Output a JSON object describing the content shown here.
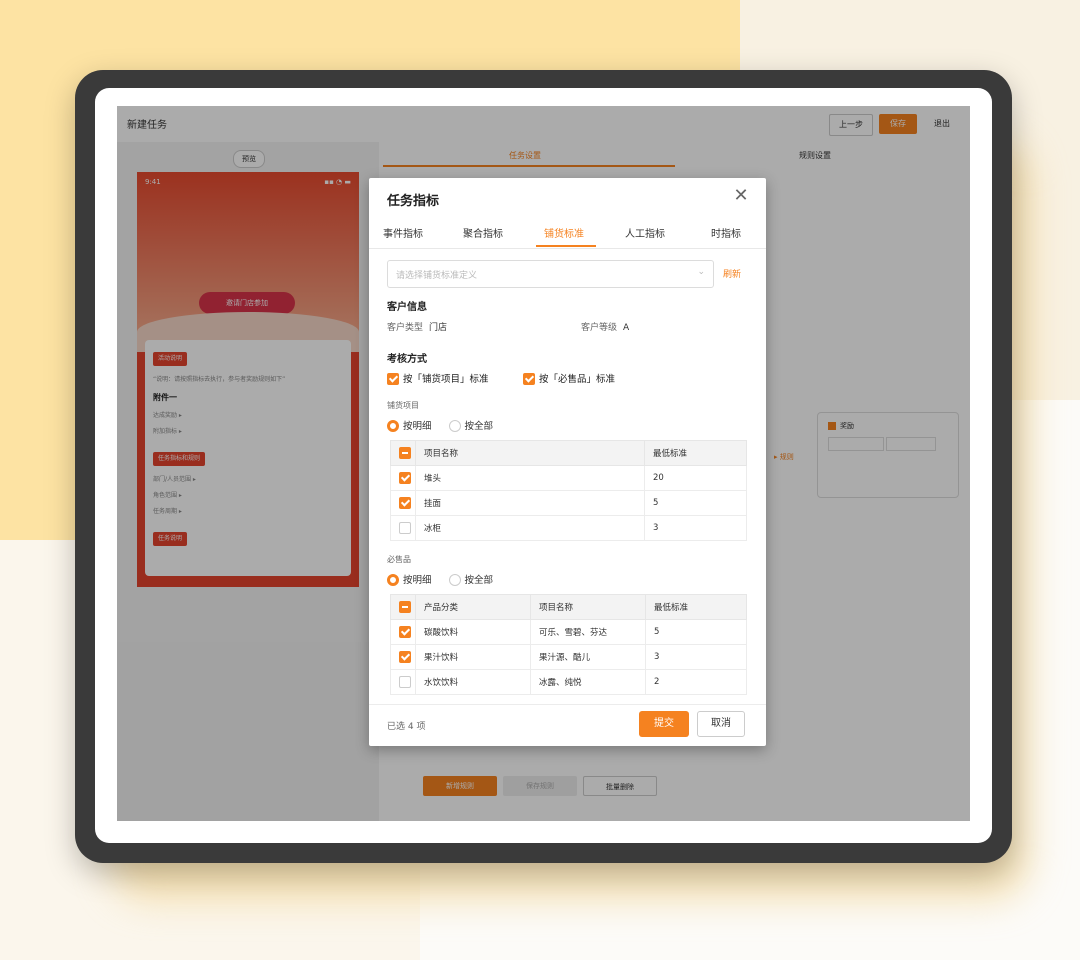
{
  "colors": {
    "accent": "#f58220",
    "phone_red": "#e4432e",
    "bg_yellow": "#fde3a3"
  },
  "app": {
    "title": "新建任务",
    "buttons": {
      "prev": "上一步",
      "save": "保存",
      "exit": "退出"
    },
    "preview_label": "预览",
    "right_tabs": [
      "任务设置",
      "规则设置"
    ],
    "bottom_buttons": [
      "新增规则",
      "保存规则",
      "批量删除"
    ]
  },
  "phone": {
    "time": "9:41",
    "status": "▪▪ ◔ ▬",
    "center_button": "邀请门店参加",
    "tags": [
      "活动说明",
      "任务指标和规则",
      "任务说明"
    ],
    "note": "“说明：请按照指标去执行，参与者奖励规则如下”",
    "subtitle": "附件一",
    "lines": [
      "达成奖励 ▸",
      "附加指标 ▸",
      "部门/人员范围 ▸",
      "角色范围 ▸",
      "任务周期 ▸"
    ]
  },
  "modal": {
    "title": "任务指标",
    "close": "✕",
    "tabs": [
      "事件指标",
      "聚合指标",
      "铺货标准",
      "人工指标",
      "时指标"
    ],
    "active_tab": 2,
    "select_placeholder": "请选择铺货标准定义",
    "refresh": "刷新",
    "customer": {
      "heading": "客户信息",
      "type_label": "客户类型",
      "type_value": "门店",
      "level_label": "客户等级",
      "level_value": "A"
    },
    "assessment": {
      "heading": "考核方式",
      "opt1": "按「铺货项目」标准",
      "opt2": "按「必售品」标准"
    },
    "display_items": {
      "heading": "铺货项目",
      "radio_on": "按明细",
      "radio_off": "按全部",
      "columns": [
        "项目名称",
        "最低标准"
      ],
      "rows": [
        {
          "checked": true,
          "name": "堆头",
          "min": "20"
        },
        {
          "checked": true,
          "name": "挂面",
          "min": "5"
        },
        {
          "checked": false,
          "name": "冰柜",
          "min": "3"
        }
      ]
    },
    "must_sell": {
      "heading": "必售品",
      "radio_on": "按明细",
      "radio_off": "按全部",
      "columns": [
        "产品分类",
        "项目名称",
        "最低标准"
      ],
      "rows": [
        {
          "checked": true,
          "category": "碳酸饮料",
          "name": "可乐、雪碧、芬达",
          "min": "5"
        },
        {
          "checked": true,
          "category": "果汁饮料",
          "name": "果汁源、酷儿",
          "min": "3"
        },
        {
          "checked": false,
          "category": "水饮饮料",
          "name": "冰露、纯悦",
          "min": "2"
        }
      ]
    },
    "footer": {
      "selected": "已选 4 项",
      "submit": "提交",
      "cancel": "取消"
    }
  },
  "node": {
    "label": "奖励",
    "link": "▸ 规则"
  }
}
